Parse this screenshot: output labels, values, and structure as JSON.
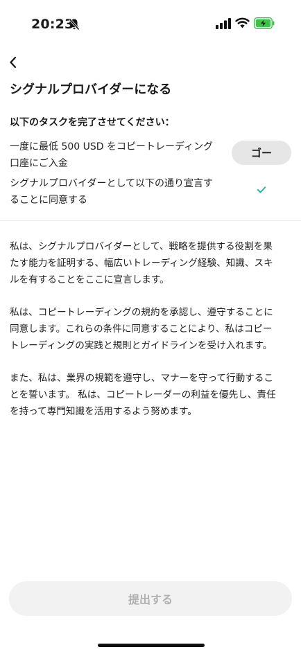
{
  "status_bar": {
    "time": "20:23",
    "icons": [
      "bell-slash-icon",
      "signal-icon",
      "wifi-icon",
      "battery-charging-icon"
    ],
    "battery_color": "#3cc44a"
  },
  "header": {
    "back_icon": "chevron-left-icon",
    "title": "シグナルプロバイダーになる"
  },
  "tasks": {
    "heading": "以下のタスクを完了させてください：",
    "items": [
      {
        "lines": [
          "一度に最低 500 USD をコピートレーディング",
          "口座にご入金"
        ],
        "action_label": "ゴー"
      },
      {
        "lines": [
          "シグナルプロバイダーとして以下の通り宣言す",
          "ることに同意する"
        ],
        "status_icon": "checkmark-icon",
        "completed": true
      }
    ]
  },
  "declaration": {
    "paragraphs": [
      [
        "私は、シグナルプロバイダーとして、戦略を提供する役割を果",
        "たす能力を証明する、幅広いトレーディング経験、知識、スキ",
        "ルを有することをここに宣言します。"
      ],
      [
        "私は、コピートレーディングの規約を承認し、遵守することに",
        "同意します。これらの条件に同意することにより、私はコピー",
        "トレーディングの実践と規則とガイドラインを受け入れます。"
      ],
      [
        "また、私は、業界の規範を遵守し、マナーを守って行動するこ",
        "とを誓います。 私は、コピートレーダーの利益を優先し、責任",
        "を持って専門知識を活用するよう努めます。"
      ]
    ]
  },
  "footer": {
    "submit_label": "提出する",
    "submit_enabled": false
  },
  "colors": {
    "accent": "#2bb5a6",
    "button_bg": "#e6e6e6",
    "disabled_text": "#b0b0b0"
  }
}
